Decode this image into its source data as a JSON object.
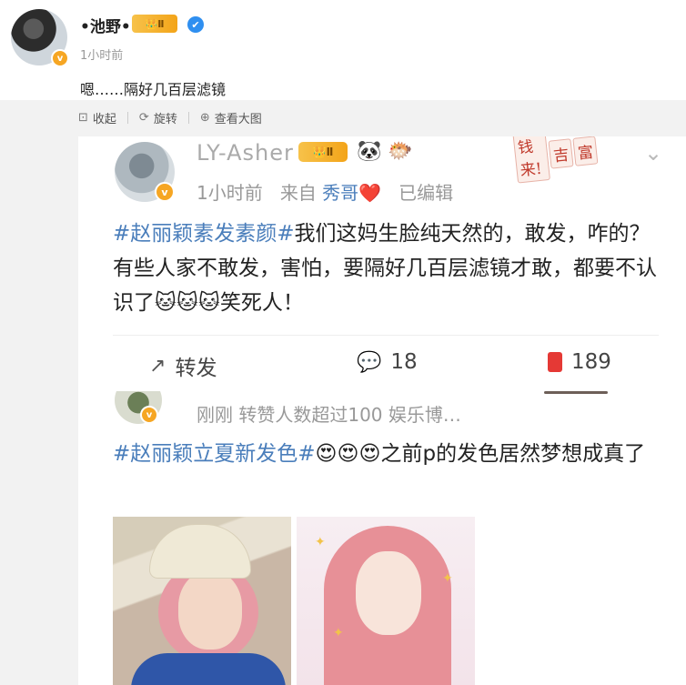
{
  "post": {
    "author": "•池野•",
    "crown_badge": "Ⅱ",
    "verified": "v",
    "time": "1小时前",
    "text": "嗯……隔好几百层滤镜"
  },
  "toolbar": {
    "collapse": "收起",
    "rotate": "旋转",
    "view_large": "查看大图"
  },
  "embedded": {
    "author": "LY-Asher",
    "crown_badge": "Ⅱ",
    "emojis": [
      "🐼",
      "🐡"
    ],
    "stamp": [
      "钱来!",
      "吉",
      "富"
    ],
    "meta_time": "1小时前",
    "meta_from": "来自",
    "meta_source": "秀哥",
    "meta_heart": "❤️",
    "meta_edited": "已编辑",
    "hashtag": "#赵丽颖素发素颜#",
    "body": "我们这妈生脸纯天然的，敢发，咋的？有些人家不敢发，害怕，要隔好几百层滤镜才敢，都要不认识了🐱🐱🐱笑死人！",
    "repost_label": "转发",
    "comments_count": "18",
    "likes_count": "189",
    "post2_meta": "刚刚  转赞人数超过100  娱乐博…",
    "post2_hashtag": "#赵丽颖立夏新发色#",
    "post2_body": "😍😍😍之前p的发色居然梦想成真了"
  },
  "colors": {
    "hashtag": "#4a7ebb",
    "badge_gold": "#f3a419",
    "verify_blue": "#2f8ff0",
    "like_red": "#e53935"
  }
}
